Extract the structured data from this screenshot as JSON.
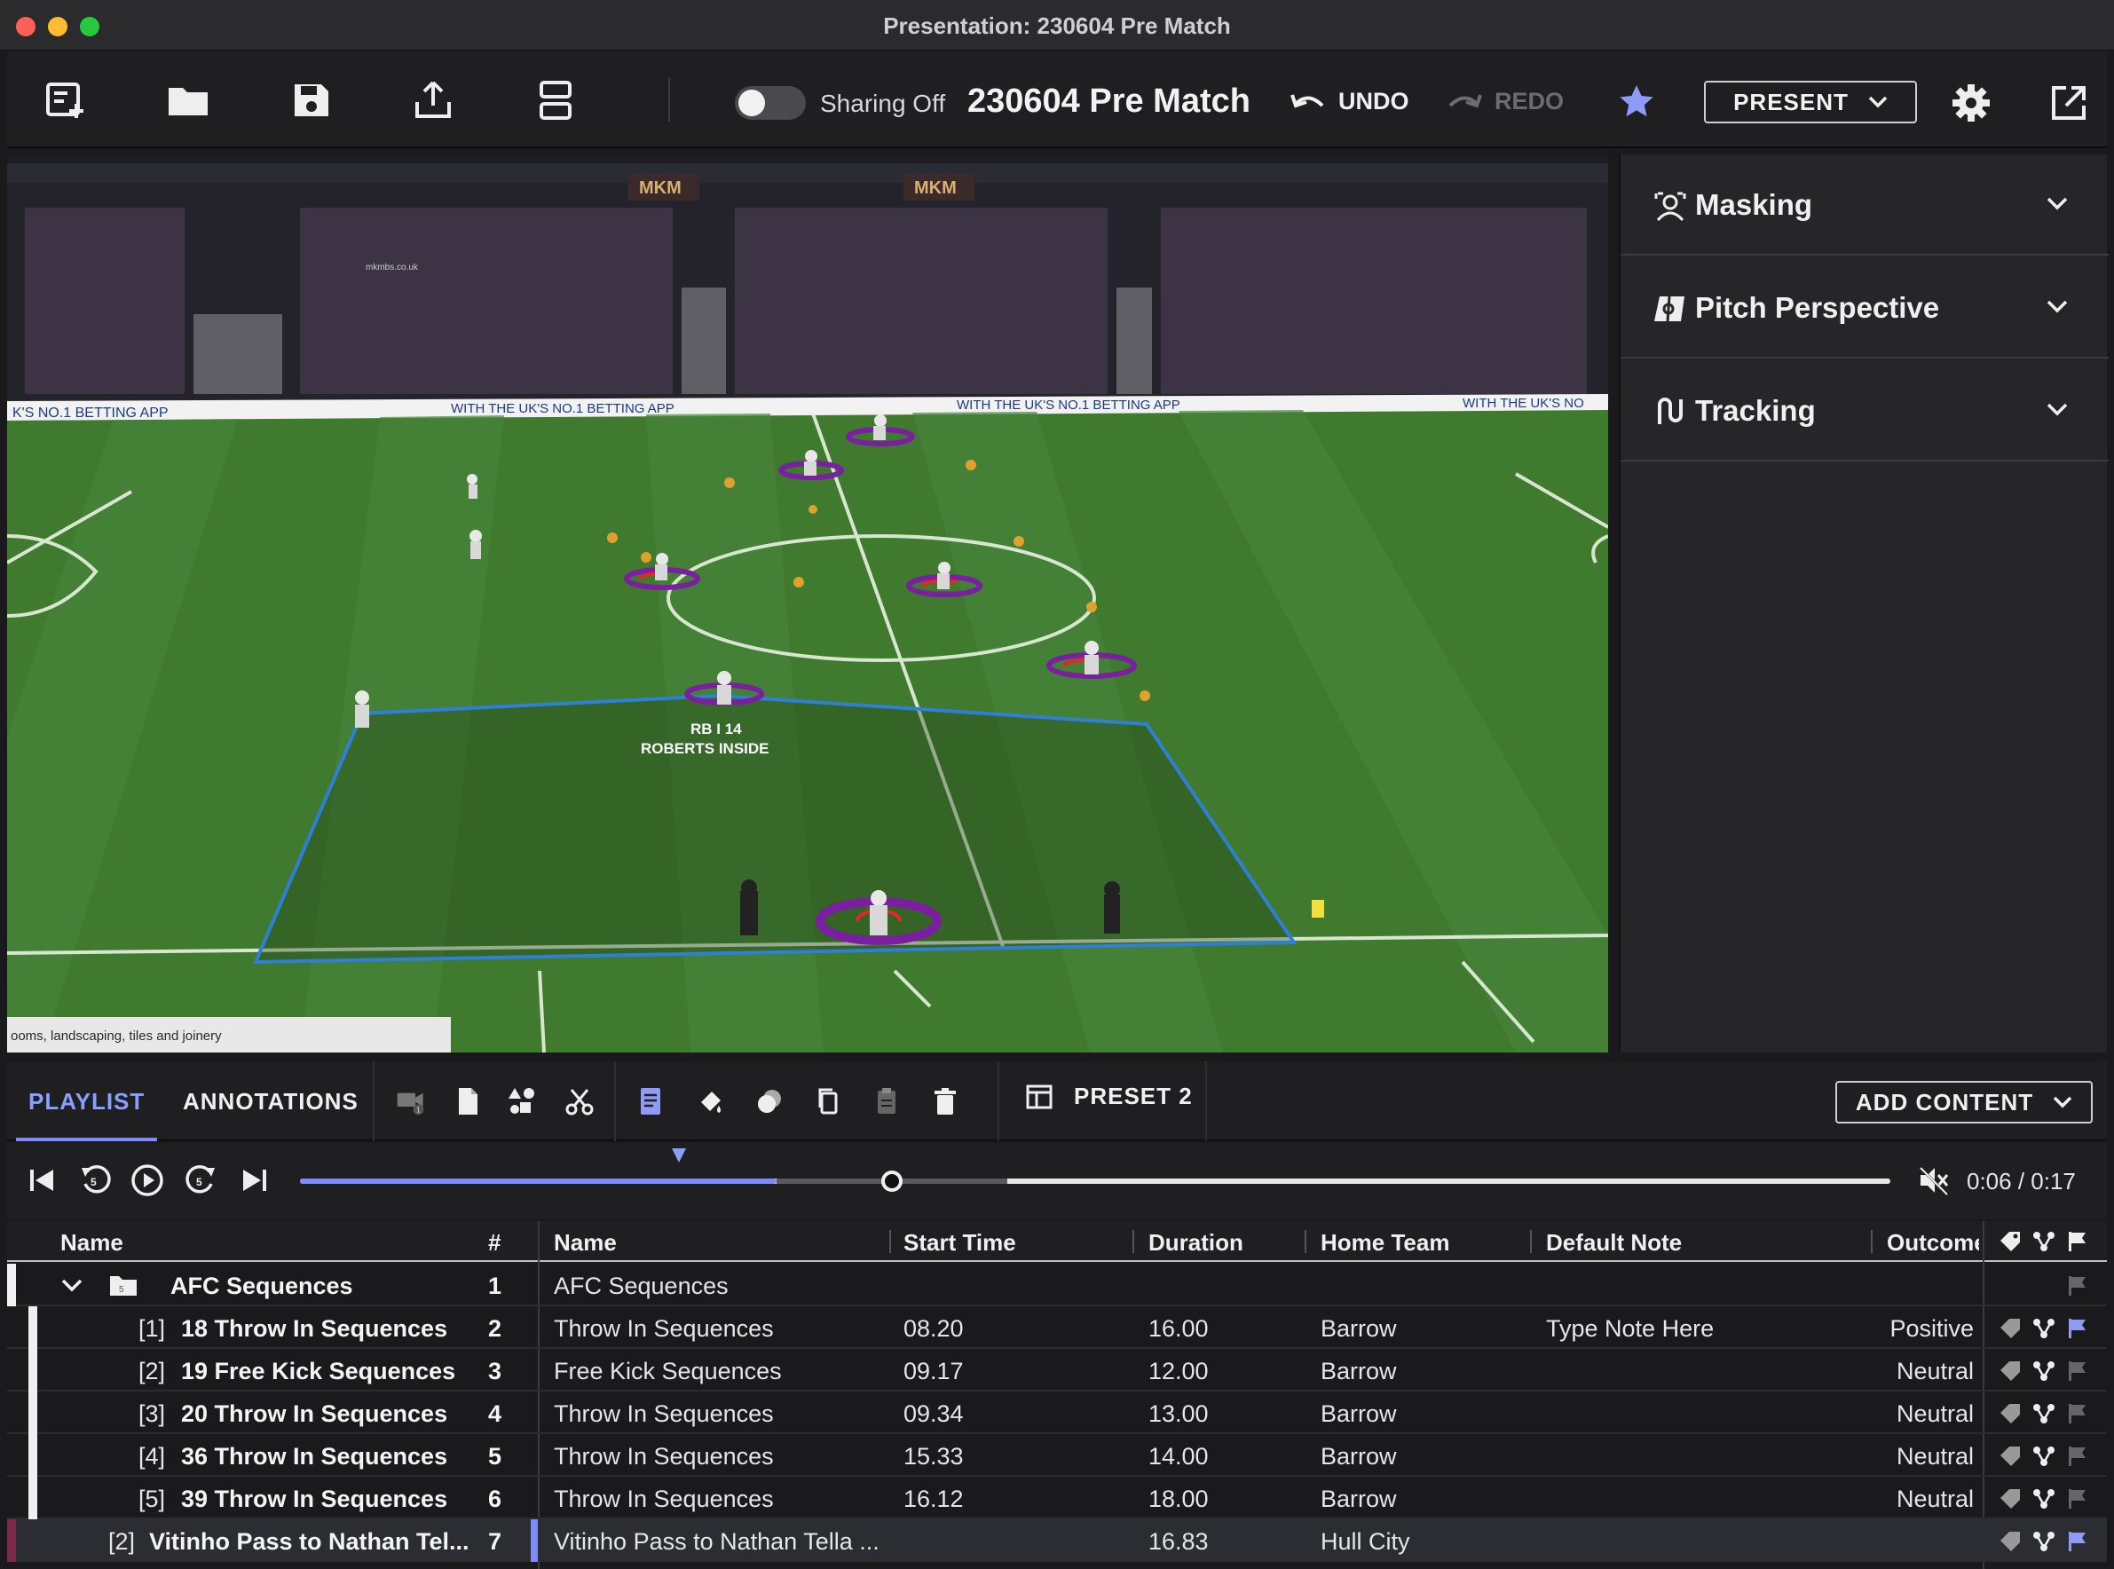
{
  "window": {
    "title": "Presentation: 230604 Pre Match"
  },
  "toolbar": {
    "sharing_label": "Sharing Off",
    "presentation_name": "230604 Pre Match",
    "undo_label": "UNDO",
    "redo_label": "REDO",
    "present_label": "PRESENT",
    "icons": [
      "new-slide-icon",
      "folder-icon",
      "save-icon",
      "export-icon",
      "layout-icon",
      "star-icon",
      "gear-icon",
      "popout-icon"
    ]
  },
  "video": {
    "annotation_line1": "RB I 14",
    "annotation_line2": "ROBERTS INSIDE",
    "board_text": "WITH THE UK'S NO.1 BETTING APP",
    "board_text_left": "K'S NO.1 BETTING APP",
    "board_text_right": "WITH THE UK'S NO",
    "sponsor_text": "mkmbs.co.uk",
    "banner_stand_1": "MKM",
    "banner_stand_2": "MKM",
    "bottom_text": "ooms, landscaping, tiles and joinery",
    "colors": {
      "pitch": "#3f7a2e",
      "zone_line": "#2f7fd6",
      "ring_outer": "#7a1fa0",
      "ring_inner": "#e3262a"
    }
  },
  "right_panel": {
    "sections": [
      {
        "label": "Masking",
        "icon": "masking-icon"
      },
      {
        "label": "Pitch Perspective",
        "icon": "pitch-perspective-icon"
      },
      {
        "label": "Tracking",
        "icon": "tracking-icon"
      }
    ]
  },
  "tabs": {
    "playlist": "PLAYLIST",
    "annotations": "ANNOTATIONS",
    "preset": "PRESET 2",
    "add_content": "ADD CONTENT",
    "clip_badge": "1"
  },
  "transport": {
    "time": "0:06 / 0:17",
    "progress": 0.35
  },
  "table": {
    "headers": {
      "name": "Name",
      "num": "#",
      "name2": "Name",
      "start_time": "Start Time",
      "duration": "Duration",
      "home_team": "Home Team",
      "default_note": "Default Note",
      "outcome": "Outcome"
    },
    "group": {
      "label": "AFC Sequences",
      "num": "1",
      "name2": "AFC Sequences",
      "folder_badge": "5"
    },
    "rows": [
      {
        "index": "[1]",
        "label": "18 Throw In Sequences",
        "num": "2",
        "name": "Throw In Sequences",
        "start": "08.20",
        "duration": "16.00",
        "home": "Barrow",
        "note": "Type Note Here",
        "outcome": "Positive"
      },
      {
        "index": "[2]",
        "label": "19 Free Kick Sequences",
        "num": "3",
        "name": "Free Kick Sequences",
        "start": "09.17",
        "duration": "12.00",
        "home": "Barrow",
        "note": "",
        "outcome": "Neutral"
      },
      {
        "index": "[3]",
        "label": "20 Throw In Sequences",
        "num": "4",
        "name": "Throw In Sequences",
        "start": "09.34",
        "duration": "13.00",
        "home": "Barrow",
        "note": "",
        "outcome": "Neutral"
      },
      {
        "index": "[4]",
        "label": "36 Throw In Sequences",
        "num": "5",
        "name": "Throw In Sequences",
        "start": "15.33",
        "duration": "14.00",
        "home": "Barrow",
        "note": "",
        "outcome": "Neutral"
      },
      {
        "index": "[5]",
        "label": "39 Throw In Sequences",
        "num": "6",
        "name": "Throw In Sequences",
        "start": "16.12",
        "duration": "18.00",
        "home": "Barrow",
        "note": "",
        "outcome": "Neutral"
      }
    ],
    "selected": {
      "index": "[2]",
      "label": "Vitinho Pass to Nathan Tel...",
      "num": "7",
      "name": "Vitinho Pass to Nathan Tella ...",
      "start": "",
      "duration": "16.83",
      "home": "Hull City",
      "note": "",
      "outcome": ""
    }
  }
}
